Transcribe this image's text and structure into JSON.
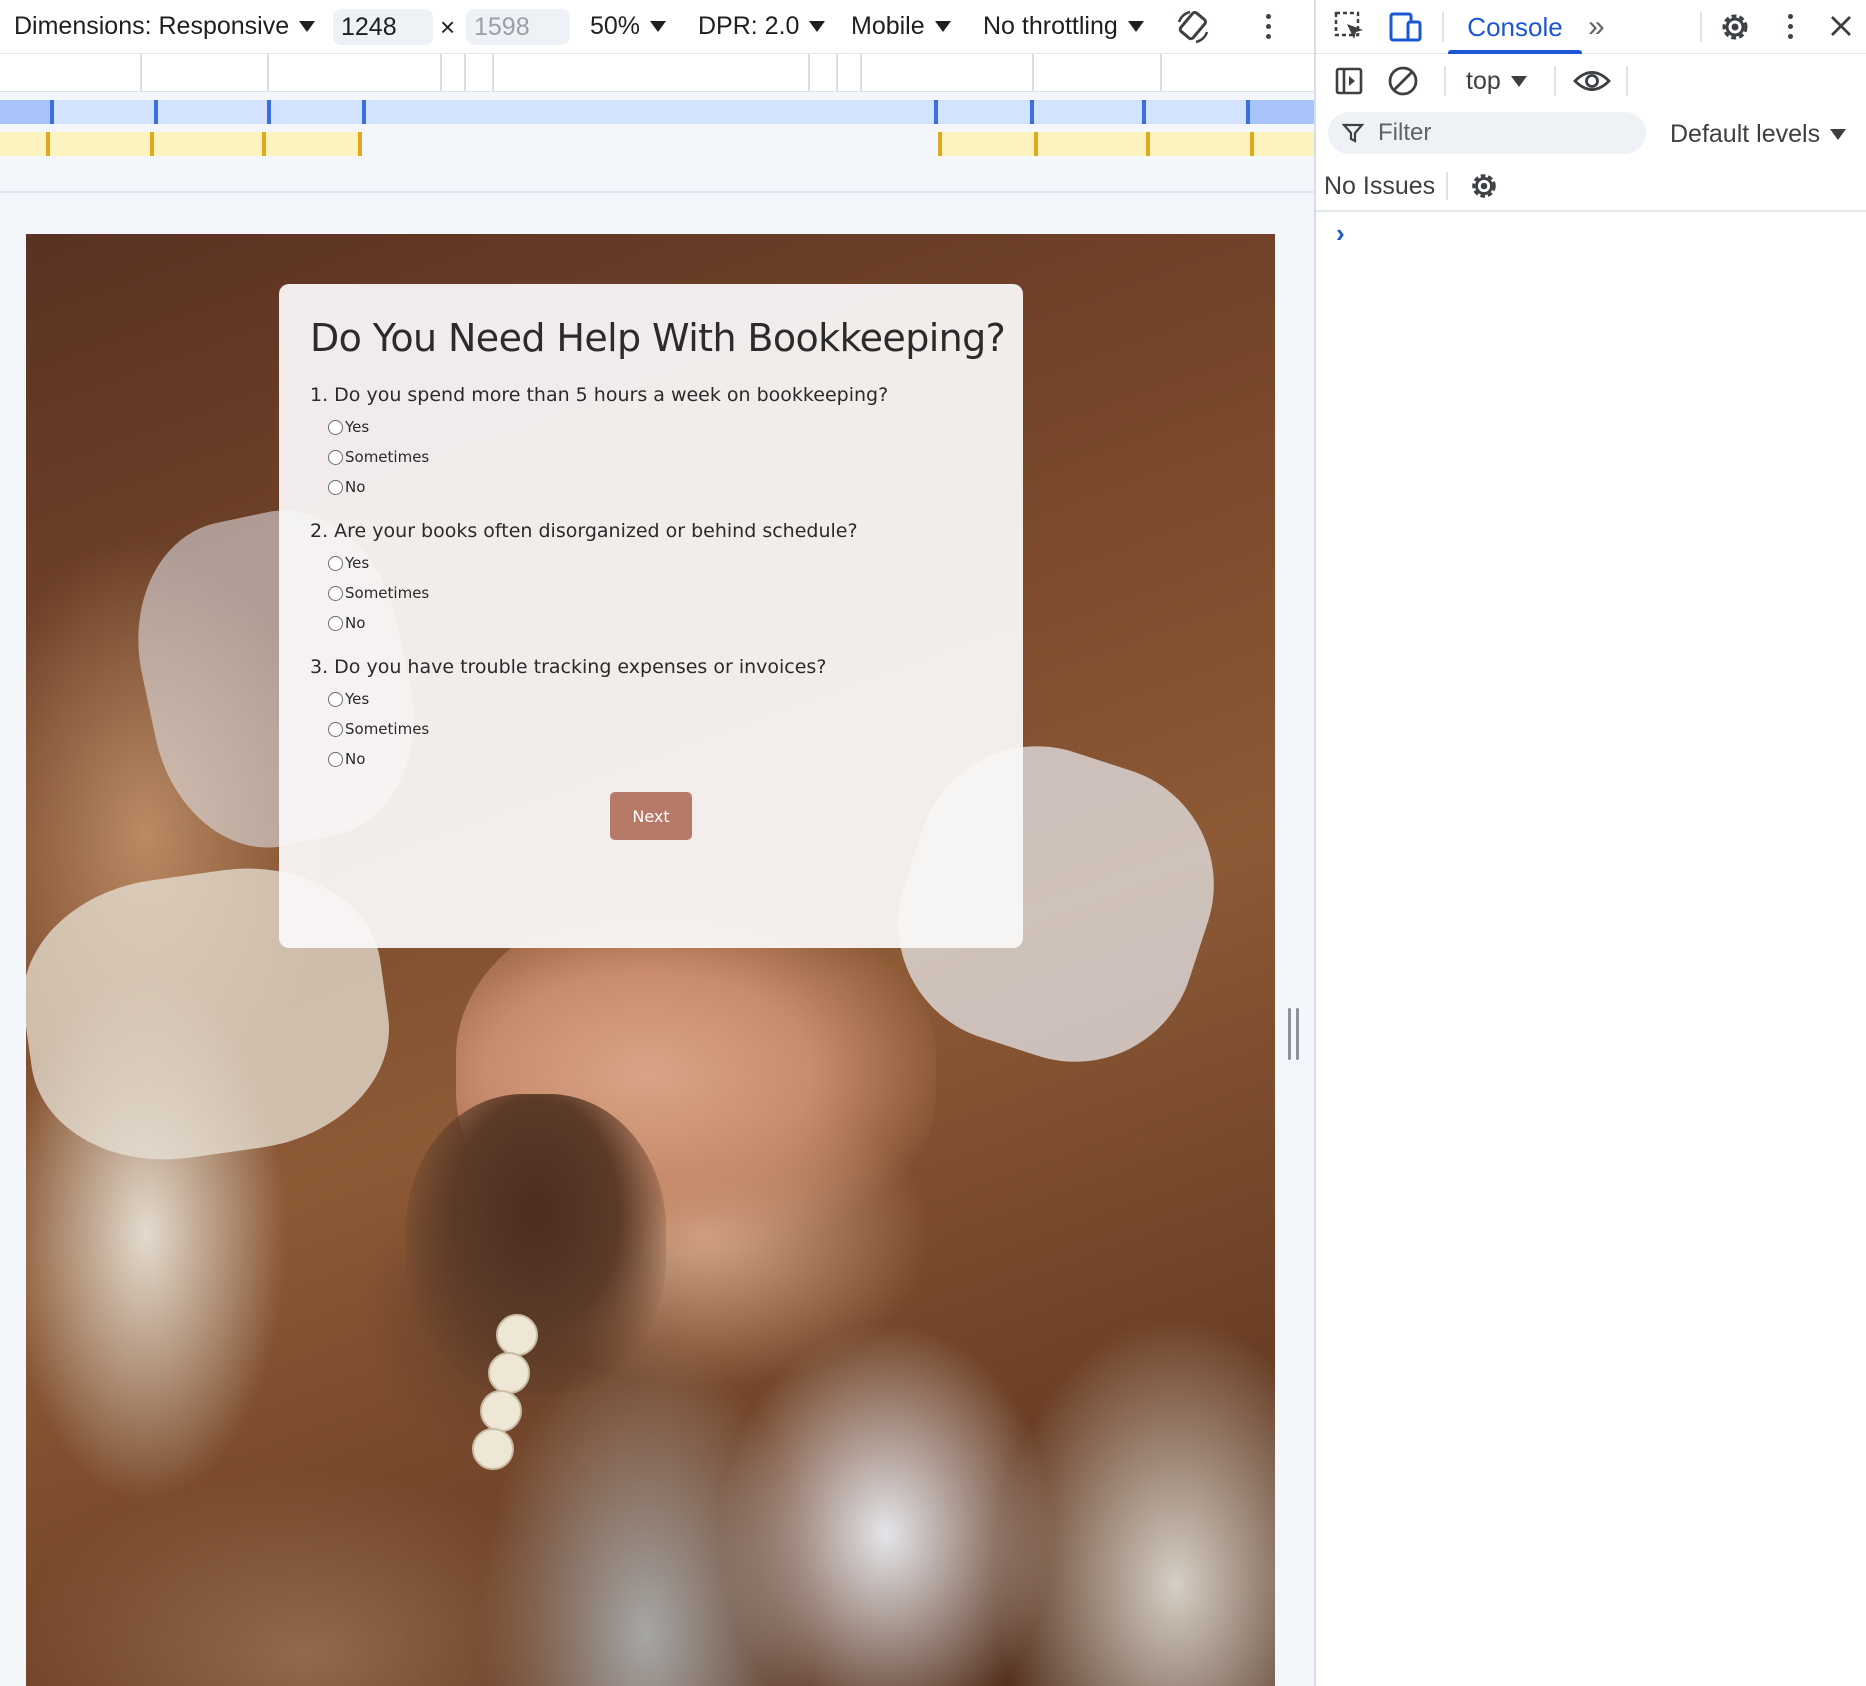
{
  "device_toolbar": {
    "dimensions_label": "Dimensions: Responsive",
    "width_value": "1248",
    "height_placeholder": "1598",
    "times_sign": "×",
    "zoom_label": "50%",
    "dpr_label": "DPR: 2.0",
    "device_type_label": "Mobile",
    "throttling_label": "No throttling",
    "rotate_icon": "rotate-icon",
    "more_icon": "more-vert-icon"
  },
  "survey": {
    "title": "Do You Need Help With Bookkeeping?",
    "questions": [
      {
        "text": "1. Do you spend more than 5 hours a week on bookkeeping?",
        "options": [
          "Yes",
          "Sometimes",
          "No"
        ]
      },
      {
        "text": "2. Are your books often disorganized or behind schedule?",
        "options": [
          "Yes",
          "Sometimes",
          "No"
        ]
      },
      {
        "text": "3. Do you have trouble tracking expenses or invoices?",
        "options": [
          "Yes",
          "Sometimes",
          "No"
        ]
      }
    ],
    "next_label": "Next",
    "accent_color": "#b87a68",
    "background_image": "team-hands-stacked-photo"
  },
  "devtools": {
    "active_tab": "Console",
    "more_tabs_label": "»",
    "context_label": "top",
    "filter_placeholder": "Filter",
    "levels_label": "Default levels",
    "issues_label": "No Issues",
    "prompt_symbol": "›",
    "accent_color": "#1a57d1"
  }
}
